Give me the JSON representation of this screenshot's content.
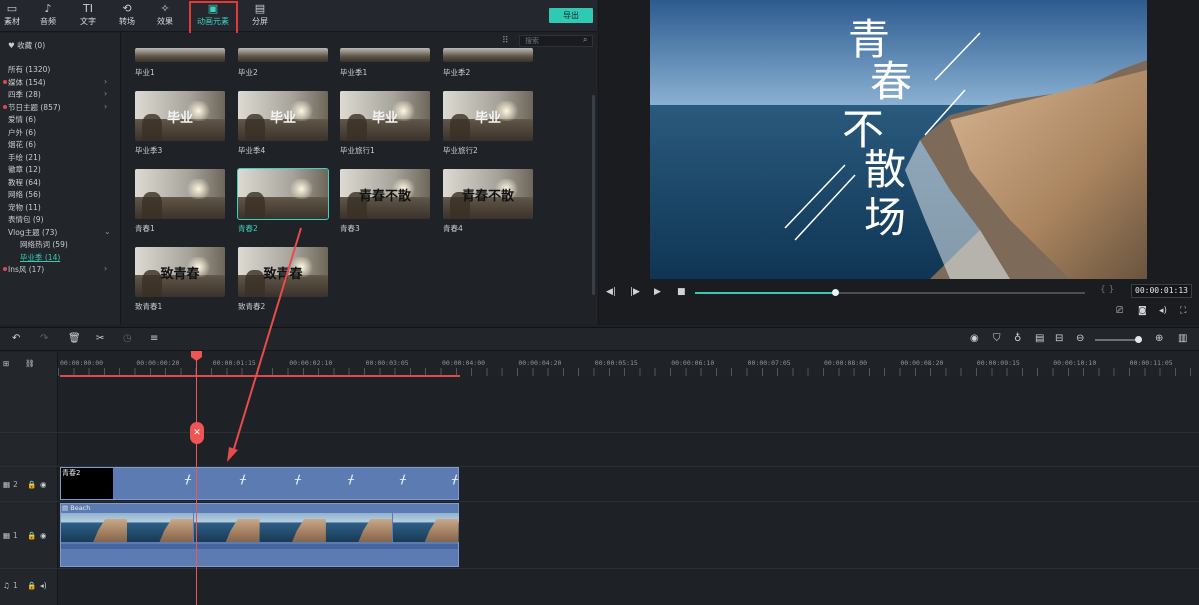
{
  "toolbar": {
    "tabs": [
      {
        "label": "素材",
        "icon": "folder-icon"
      },
      {
        "label": "音频",
        "icon": "music-note-icon"
      },
      {
        "label": "文字",
        "icon": "text-icon"
      },
      {
        "label": "转场",
        "icon": "transition-icon"
      },
      {
        "label": "效果",
        "icon": "effects-icon"
      },
      {
        "label": "动画元素",
        "icon": "image-icon"
      },
      {
        "label": "分屏",
        "icon": "split-screen-icon"
      }
    ],
    "active_tab": "动画元素",
    "export_label": "导出"
  },
  "sidebar": {
    "favorites": "收藏 (0)",
    "categories": [
      {
        "label": "所有 (1320)"
      },
      {
        "label": "媒体 (154)",
        "dot": true,
        "chevron": true
      },
      {
        "label": "四季 (28)",
        "chevron": true
      },
      {
        "label": "节日主题 (857)",
        "dot": true,
        "chevron": true
      },
      {
        "label": "爱情 (6)"
      },
      {
        "label": "户外 (6)"
      },
      {
        "label": "烟花 (6)"
      },
      {
        "label": "手绘 (21)"
      },
      {
        "label": "徽章 (12)"
      },
      {
        "label": "教程 (64)"
      },
      {
        "label": "网络 (56)"
      },
      {
        "label": "宠物 (11)"
      },
      {
        "label": "表情包 (9)"
      },
      {
        "label": "Vlog主题 (73)",
        "chevron_down": true
      },
      {
        "label": "网络热词 (59)",
        "sub": true
      },
      {
        "label": "毕业季 (14)",
        "sub": true,
        "selected": true
      },
      {
        "label": "Ins风 (17)",
        "dot": true,
        "chevron": true
      }
    ]
  },
  "grid": {
    "search_placeholder": "搜索",
    "top_row_labels": [
      "毕业1",
      "毕业2",
      "毕业季1",
      "毕业季2"
    ],
    "items": [
      {
        "label": "毕业季3",
        "glyph": "毕业"
      },
      {
        "label": "毕业季4",
        "glyph": "毕业"
      },
      {
        "label": "毕业旅行1",
        "glyph": "毕业"
      },
      {
        "label": "毕业旅行2",
        "glyph": "毕业"
      },
      {
        "label": "青春1",
        "glyph": ""
      },
      {
        "label": "青春2",
        "glyph": "",
        "selected": true
      },
      {
        "label": "青春3",
        "glyph": "青春不散"
      },
      {
        "label": "青春4",
        "glyph": "青春不散"
      },
      {
        "label": "致青春1",
        "glyph": "致青春"
      },
      {
        "label": "致青春2",
        "glyph": "致青春"
      }
    ]
  },
  "preview": {
    "title_text": [
      "青",
      "春",
      "不",
      "散",
      "场"
    ],
    "timecode": "00:00:01:13",
    "markers": "{ }",
    "progress": 0.36
  },
  "timeline": {
    "ruler_labels": [
      "00:00:00:00",
      "00:00:00:20",
      "00:00:01:15",
      "00:00:02:10",
      "00:00:03:05",
      "00:00:04:00",
      "00:00:04:20",
      "00:00:05:15",
      "00:00:06:10",
      "00:00:07:05",
      "00:00:08:00",
      "00:00:08:20",
      "00:00:09:15",
      "00:00:10:10",
      "00:00:11:05"
    ],
    "tracks": [
      {
        "name": "2",
        "type": "video"
      },
      {
        "name": "1",
        "type": "video"
      },
      {
        "name": "1",
        "type": "audio"
      }
    ],
    "title_clip_name": "青春2",
    "video_clip_name": "Beach"
  },
  "colors": {
    "accent": "#3fd0c0",
    "highlight": "#e03a3a",
    "clip": "#5c7bb3"
  }
}
